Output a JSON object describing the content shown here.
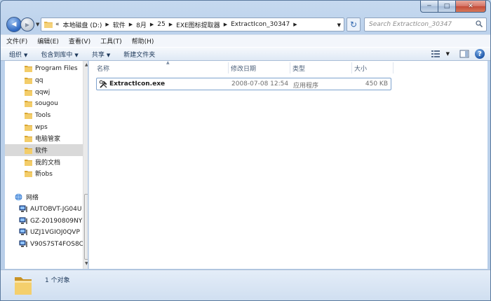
{
  "window": {
    "caption_min": "─",
    "caption_max": "□",
    "caption_close": "✕"
  },
  "nav": {
    "back_glyph": "◀",
    "forward_glyph": "▶",
    "overflow": "«",
    "breadcrumb": [
      "本地磁盘 (D:)",
      "软件",
      "8月",
      "25",
      "EXE图标提取器",
      "ExtractIcon_30347"
    ],
    "crumb_sep": "▶",
    "dropdown_glyph": "▼",
    "refresh_glyph": "↻",
    "search_placeholder": "Search ExtractIcon_30347"
  },
  "menu": [
    "文件(F)",
    "编辑(E)",
    "查看(V)",
    "工具(T)",
    "帮助(H)"
  ],
  "commands": {
    "organize": "组织",
    "include_library": "包含到库中",
    "share": "共享",
    "new_folder": "新建文件夹",
    "arrow": "▼",
    "help": "?"
  },
  "tree": {
    "folders": [
      "Program Files",
      "qq",
      "qqwj",
      "sougou",
      "Tools",
      "wps",
      "电脑管家",
      "软件",
      "我的文档",
      "新obs"
    ],
    "selected_folder": "软件",
    "network_label": "网络",
    "computers": [
      "AUTOBVT-JG04U",
      "GZ-20190809NY",
      "UZJ1VGIOJ0QVP",
      "V90S7ST4FOS8C"
    ]
  },
  "columns": {
    "name": "名称",
    "modified": "修改日期",
    "type": "类型",
    "size": "大小",
    "sort_glyph": "▲"
  },
  "files": [
    {
      "name": "ExtractIcon.exe",
      "modified": "2008-07-08 12:54",
      "type": "应用程序",
      "size": "450 KB"
    }
  ],
  "status": {
    "count_text": "1 个对象"
  },
  "colors": {
    "accent": "#3369b0",
    "chrome": "#bcd2ec",
    "selection": "#d9d9d9"
  }
}
